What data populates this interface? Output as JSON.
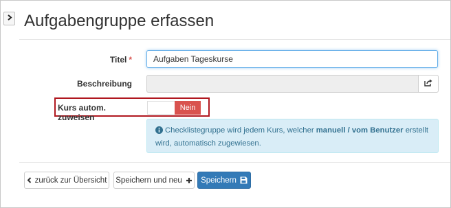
{
  "header": {
    "expand_icon": "chevron-right-icon",
    "title": "Aufgabengruppe erfassen"
  },
  "form": {
    "titel": {
      "label": "Titel",
      "required_marker": "*",
      "value": "Aufgaben Tageskurse"
    },
    "beschreibung": {
      "label": "Beschreibung",
      "value": "",
      "addon_icon": "share-icon"
    },
    "kurs_zuweisen": {
      "label": "Kurs autom. zuweisen",
      "toggle_value": "Nein",
      "toggle_color": "#d9534f",
      "highlight_color": "#b0171f"
    },
    "info": {
      "icon": "info-circle-icon",
      "text_before": "Checklistegruppe wird jedem Kurs, welcher ",
      "text_bold": "manuell / vom Benutzer",
      "text_after": " erstellt wird, automatisch zugewiesen."
    }
  },
  "footer": {
    "back_label": "zurück zur Übersicht",
    "back_icon": "chevron-left-icon",
    "save_new_label": "Speichern und neu",
    "save_new_icon": "plus-icon",
    "save_label": "Speichern",
    "save_icon": "floppy-disk-icon",
    "save_color": "#337ab7"
  }
}
